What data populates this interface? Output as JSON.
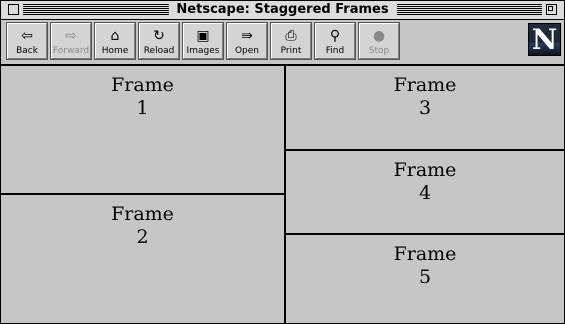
{
  "window": {
    "title": "Netscape: Staggered Frames"
  },
  "toolbar": {
    "buttons": [
      {
        "id": "back",
        "label": "Back",
        "icon": "back-arrow-icon",
        "glyph": "⇦",
        "enabled": true
      },
      {
        "id": "forward",
        "label": "Forward",
        "icon": "forward-arrow-icon",
        "glyph": "⇨",
        "enabled": false
      },
      {
        "id": "home",
        "label": "Home",
        "icon": "home-icon",
        "glyph": "⌂",
        "enabled": true
      },
      {
        "id": "reload",
        "label": "Reload",
        "icon": "reload-icon",
        "glyph": "↻",
        "enabled": true
      },
      {
        "id": "images",
        "label": "Images",
        "icon": "images-icon",
        "glyph": "▣",
        "enabled": true
      },
      {
        "id": "open",
        "label": "Open",
        "icon": "open-icon",
        "glyph": "⇛",
        "enabled": true
      },
      {
        "id": "print",
        "label": "Print",
        "icon": "print-icon",
        "glyph": "⎙",
        "enabled": true
      },
      {
        "id": "find",
        "label": "Find",
        "icon": "find-binoculars-icon",
        "glyph": "⚲",
        "enabled": true
      },
      {
        "id": "stop",
        "label": "Stop",
        "icon": "stop-icon",
        "glyph": "●",
        "enabled": false
      }
    ],
    "logo_letter": "N"
  },
  "frames": [
    {
      "id": "frame1",
      "label": "Frame\n1"
    },
    {
      "id": "frame2",
      "label": "Frame\n2"
    },
    {
      "id": "frame3",
      "label": "Frame\n3"
    },
    {
      "id": "frame4",
      "label": "Frame\n4"
    },
    {
      "id": "frame5",
      "label": "Frame\n5"
    }
  ]
}
